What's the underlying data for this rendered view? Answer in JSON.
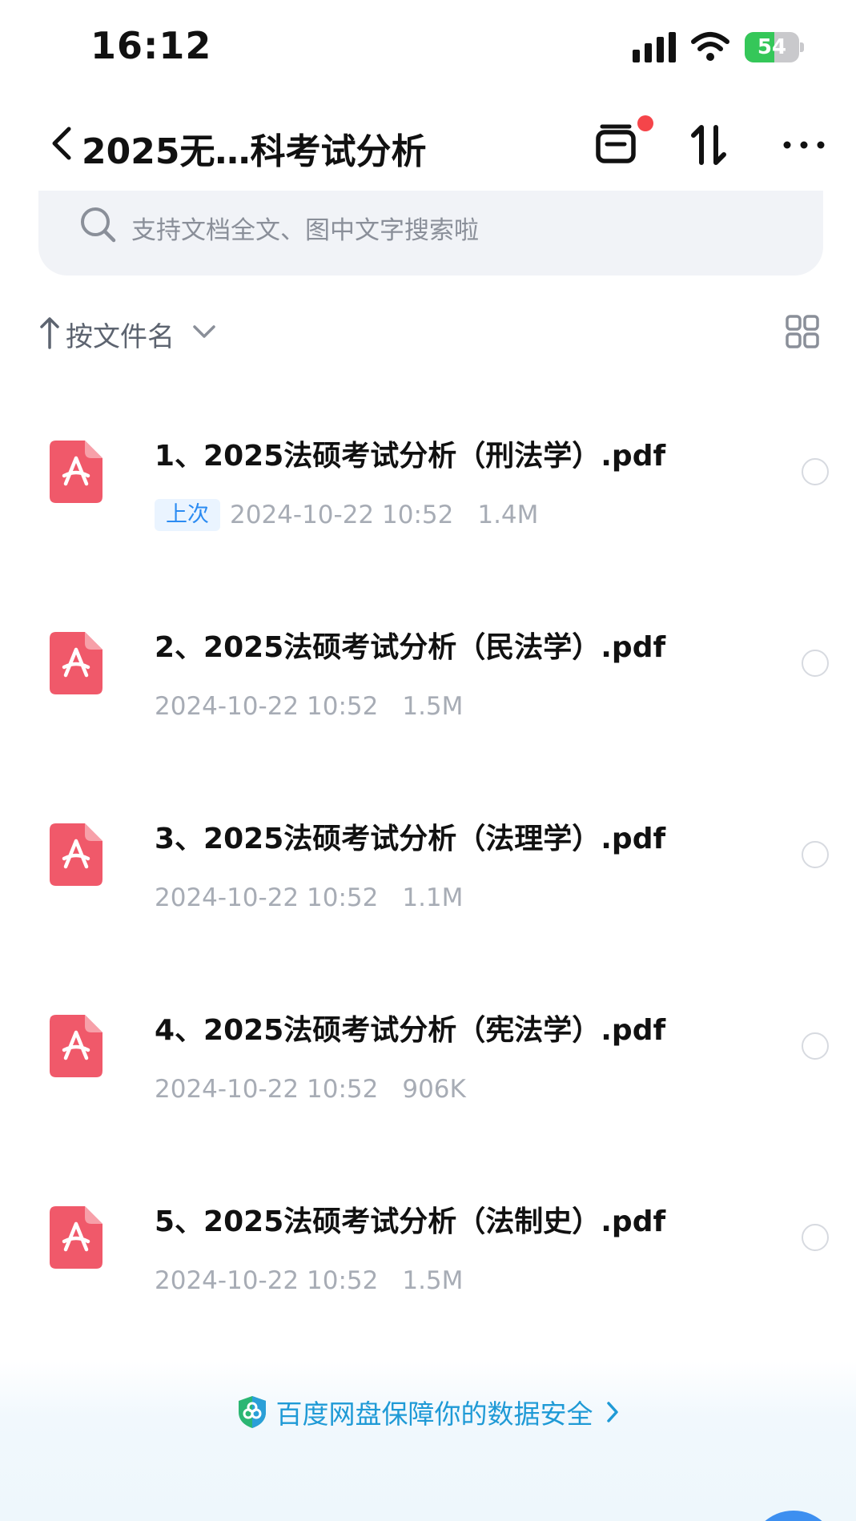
{
  "status_bar": {
    "time": "16:12",
    "battery": "54",
    "battery_level": 0.54
  },
  "header": {
    "title": "2025无…科考试分析"
  },
  "search": {
    "placeholder": "支持文档全文、图中文字搜索啦"
  },
  "sort": {
    "label": "按文件名"
  },
  "files": [
    {
      "name": "1、2025法硕考试分析（刑法学）.pdf",
      "tag": "上次",
      "date": "2024-10-22 10:52",
      "size": "1.4M"
    },
    {
      "name": "2、2025法硕考试分析（民法学）.pdf",
      "date": "2024-10-22 10:52",
      "size": "1.5M"
    },
    {
      "name": "3、2025法硕考试分析（法理学）.pdf",
      "date": "2024-10-22 10:52",
      "size": "1.1M"
    },
    {
      "name": "4、2025法硕考试分析（宪法学）.pdf",
      "date": "2024-10-22 10:52",
      "size": "906K"
    },
    {
      "name": "5、2025法硕考试分析（法制史）.pdf",
      "date": "2024-10-22 10:52",
      "size": "1.5M"
    }
  ],
  "footer": {
    "security_text": "百度网盘保障你的数据安全"
  },
  "colors": {
    "accent": "#2b8bf2",
    "pdf": "#f0596a",
    "security": "#1f9ad6",
    "badge": "#f5454a"
  }
}
